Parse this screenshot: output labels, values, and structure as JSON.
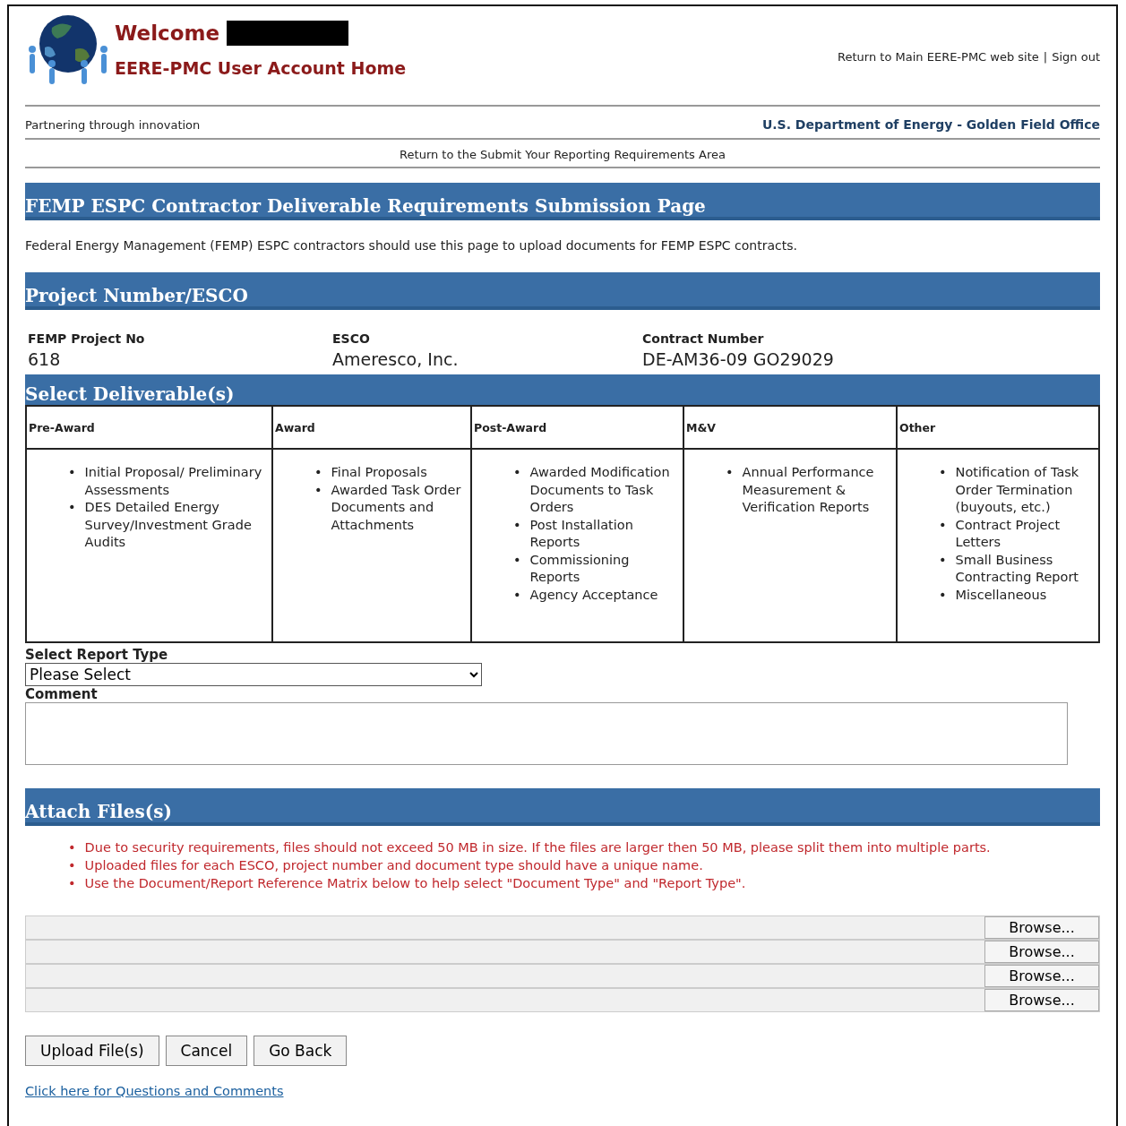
{
  "header": {
    "welcome": "Welcome",
    "title": "EERE-PMC User Account Home",
    "links": [
      {
        "label": "Return to Main EERE-PMC web site"
      },
      {
        "label": "Sign out"
      }
    ],
    "separator": "|",
    "tagline": "Partnering through innovation",
    "office": "U.S. Department of Energy - Golden Field Office",
    "return_link": "Return to the Submit Your Reporting Requirements Area"
  },
  "page_title": "FEMP ESPC Contractor Deliverable Requirements Submission Page",
  "intro": "Federal Energy Management (FEMP) ESPC contractors should use this page to upload documents for FEMP ESPC contracts.",
  "project_section": {
    "title": "Project Number/ESCO",
    "fields": [
      {
        "label": "FEMP Project No",
        "value": "618"
      },
      {
        "label": "ESCO",
        "value": "Ameresco, Inc."
      },
      {
        "label": "Contract Number",
        "value": "DE-AM36-09 GO29029"
      }
    ]
  },
  "deliverables": {
    "title": "Select Deliverable(s)",
    "columns": [
      {
        "heading": "Pre-Award",
        "items": [
          {
            "marker": "•",
            "text": "Initial Proposal/ Preliminary Assessments"
          },
          {
            "marker": "•",
            "text": "DES Detailed Energy Survey/Investment Grade Audits"
          }
        ]
      },
      {
        "heading": "Award",
        "items": [
          {
            "marker": "•",
            "text": "Final Proposals"
          },
          {
            "marker": "•",
            "text": "Awarded Task Order Documents and Attachments"
          }
        ]
      },
      {
        "heading": "Post-Award",
        "items": [
          {
            "marker": "•",
            "text": "Awarded Modification Documents to Task Orders"
          },
          {
            "marker": "•",
            "text": "Post Installation Reports"
          },
          {
            "marker": "•",
            "text": "Commissioning Reports"
          },
          {
            "marker": "•",
            "text": "Agency Acceptance"
          }
        ]
      },
      {
        "heading": "M&V",
        "items": [
          {
            "marker": "•",
            "text": "Annual Performance Measurement & Verification Reports"
          }
        ]
      },
      {
        "heading": "Other",
        "items": [
          {
            "marker": "•",
            "text": "Notification of Task Order Termination (buyouts, etc.)"
          },
          {
            "marker": "•",
            "text": "Contract Project Letters"
          },
          {
            "marker": "•",
            "text": "Small Business Contracting Report"
          },
          {
            "marker": "•",
            "text": "Miscellaneous"
          }
        ]
      }
    ]
  },
  "report_type": {
    "label": "Select Report Type",
    "value": "Please Select"
  },
  "comment": {
    "label": "Comment"
  },
  "attach": {
    "title": "Attach Files(s)",
    "notes": [
      {
        "marker": "•",
        "text": "Due to security requirements, files should not exceed 50 MB in size. If the files are larger then 50 MB, please split them into multiple parts."
      },
      {
        "marker": "•",
        "text": "Uploaded files for each ESCO, project number and document type should have a unique name."
      },
      {
        "marker": "•",
        "text": "Use the Document/Report Reference Matrix below to help select \"Document Type\" and \"Report Type\"."
      }
    ],
    "files": [
      {
        "button": "Browse..."
      },
      {
        "button": "Browse..."
      },
      {
        "button": "Browse..."
      },
      {
        "button": "Browse..."
      }
    ]
  },
  "buttons": [
    "Upload File(s)",
    "Cancel",
    "Go Back"
  ],
  "footer_link": "Click here for Questions and Comments"
}
